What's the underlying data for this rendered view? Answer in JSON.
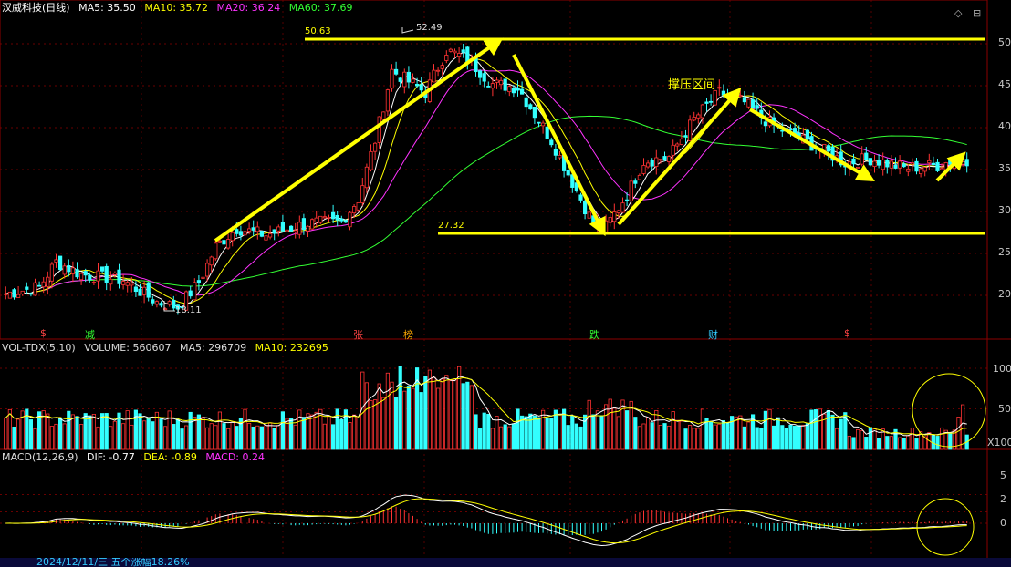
{
  "header": {
    "title": "汉威科技(日线)",
    "ma": [
      {
        "label": "MA5: 35.50",
        "color": "#ffffff"
      },
      {
        "label": "MA10: 35.72",
        "color": "#ffff00"
      },
      {
        "label": "MA20: 36.24",
        "color": "#ff33ff"
      },
      {
        "label": "MA60: 37.69",
        "color": "#33ff33"
      }
    ]
  },
  "volume_header": [
    {
      "label": "VOL-TDX(5,10)",
      "color": "#dddddd"
    },
    {
      "label": "VOLUME: 560607",
      "color": "#dddddd"
    },
    {
      "label": "MA5: 296709",
      "color": "#dddddd"
    },
    {
      "label": "MA10: 232695",
      "color": "#ffff00"
    }
  ],
  "macd_header": [
    {
      "label": "MACD(12,26,9)",
      "color": "#dddddd"
    },
    {
      "label": "DIF: -0.77",
      "color": "#ffffff"
    },
    {
      "label": "DEA: -0.89",
      "color": "#ffff00"
    },
    {
      "label": "MACD: 0.24",
      "color": "#ff33ff"
    }
  ],
  "bottom_bar": "2024/12/11/三 五个涨幅18.26%",
  "price_axis_ticks": [
    "50",
    "45",
    "40",
    "35",
    "30",
    "25",
    "20"
  ],
  "volume_axis_ticks": [
    "100",
    "50"
  ],
  "volume_unit": "X100",
  "macd_axis_ticks": [
    "5",
    "2",
    "0"
  ],
  "annotations": {
    "high_label": "52.49",
    "low_label": "18.11",
    "resistance_label": "50.63",
    "support_label": "27.32",
    "zone_text": "撑压区间"
  },
  "events": [
    {
      "text": "$",
      "color": "#ff4444"
    },
    {
      "text": "减",
      "color": "#33ff33"
    },
    {
      "text": "张",
      "color": "#ff4444"
    },
    {
      "text": "榜",
      "color": "#ffaa00"
    },
    {
      "text": "跌",
      "color": "#33ff33"
    },
    {
      "text": "财",
      "color": "#33ccff"
    },
    {
      "text": "$",
      "color": "#ff4444"
    }
  ],
  "colors": {
    "up": "#ff3333",
    "down": "#33ffff",
    "ma5": "#ffffff",
    "ma10": "#ffff00",
    "ma20": "#ff33ff",
    "ma60": "#33ff33",
    "arrow": "#ffff00",
    "grid": "#8b0000"
  },
  "chart_data": {
    "type": "candlestick",
    "ylim": [
      17,
      52
    ],
    "close_anchors": [
      [
        0,
        20.2
      ],
      [
        8,
        21
      ],
      [
        12,
        24
      ],
      [
        18,
        22.5
      ],
      [
        28,
        21.8
      ],
      [
        36,
        19.2
      ],
      [
        41,
        18.6
      ],
      [
        46,
        21.5
      ],
      [
        50,
        25.8
      ],
      [
        55,
        28
      ],
      [
        62,
        27.2
      ],
      [
        72,
        28.6
      ],
      [
        80,
        28.8
      ],
      [
        84,
        31.5
      ],
      [
        88,
        38.5
      ],
      [
        92,
        46.8
      ],
      [
        100,
        44.2
      ],
      [
        105,
        49.2
      ],
      [
        110,
        48.2
      ],
      [
        116,
        45.2
      ],
      [
        122,
        44.8
      ],
      [
        130,
        38.5
      ],
      [
        136,
        32.5
      ],
      [
        140,
        28.5
      ],
      [
        143,
        28.2
      ],
      [
        148,
        32
      ],
      [
        152,
        36
      ],
      [
        158,
        36.5
      ],
      [
        164,
        41
      ],
      [
        170,
        44.2
      ],
      [
        176,
        43
      ],
      [
        182,
        40.5
      ],
      [
        188,
        39
      ],
      [
        194,
        37.5
      ],
      [
        200,
        35.8
      ],
      [
        206,
        36.3
      ],
      [
        214,
        35.2
      ],
      [
        222,
        35.5
      ],
      [
        226,
        36.2
      ]
    ],
    "volume_ylim": [
      0,
      120
    ],
    "macd_ylim": [
      -4,
      7
    ]
  }
}
